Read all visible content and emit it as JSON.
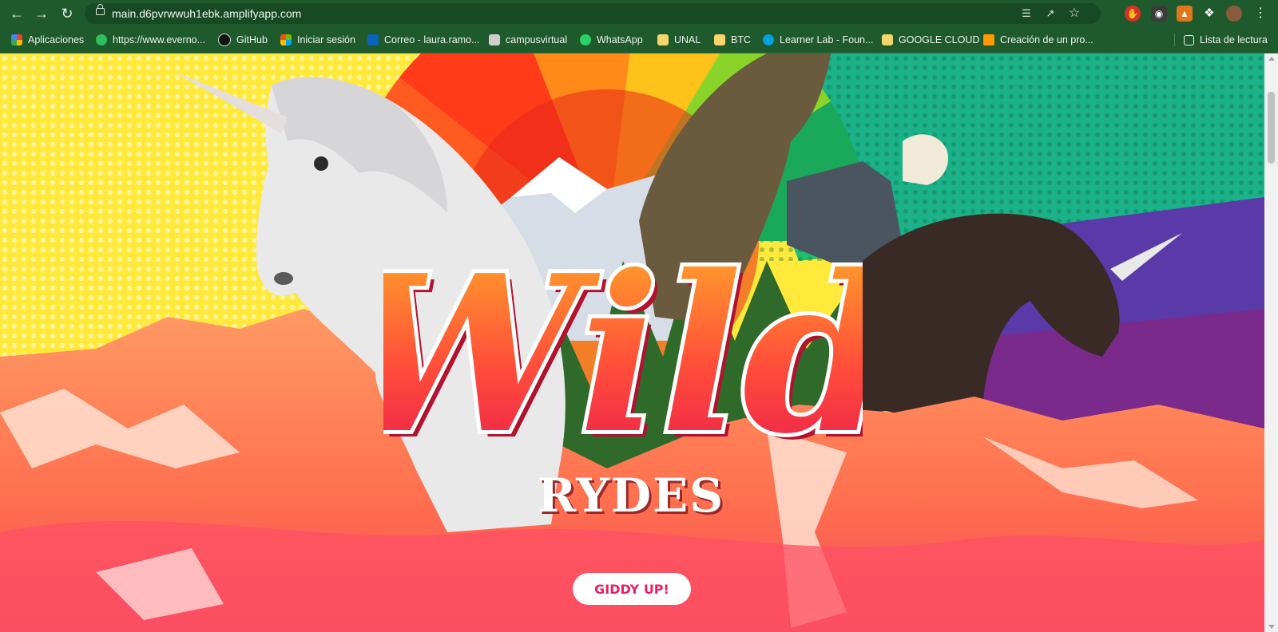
{
  "browser": {
    "url": "main.d6pvrwwuh1ebk.amplifyapp.com",
    "nav": {
      "back_icon": "arrow-left",
      "forward_icon": "arrow-right",
      "reload_icon": "reload"
    },
    "bookmarks": [
      {
        "label": "Aplicaciones",
        "icon": "apps-grid-icon",
        "color": "#e94235"
      },
      {
        "label": "https://www.everno...",
        "icon": "evernote-icon",
        "color": "#2dbe60"
      },
      {
        "label": "GitHub",
        "icon": "github-icon",
        "color": "#111111"
      },
      {
        "label": "Iniciar sesión",
        "icon": "microsoft-icon",
        "color": "#f25022"
      },
      {
        "label": "Correo - laura.ramo...",
        "icon": "outlook-icon",
        "color": "#0a64b8"
      },
      {
        "label": "campusvirtual",
        "icon": "campus-icon",
        "color": "#cfcfcf"
      },
      {
        "label": "WhatsApp",
        "icon": "whatsapp-icon",
        "color": "#25d366"
      },
      {
        "label": "UNAL",
        "icon": "folder-icon",
        "color": "#f6d66b"
      },
      {
        "label": "BTC",
        "icon": "folder-icon",
        "color": "#f6d66b"
      },
      {
        "label": "Learner Lab - Foun...",
        "icon": "salesforce-icon",
        "color": "#00a1e0"
      },
      {
        "label": "GOOGLE CLOUD",
        "icon": "folder-icon",
        "color": "#f6d66b"
      },
      {
        "label": "Creación de un pro...",
        "icon": "aws-icon",
        "color": "#ff9900"
      }
    ],
    "reading_list": "Lista de lectura"
  },
  "hero": {
    "logo_script": "Wild",
    "logo_word": "RYDES",
    "cta_label": "GIDDY UP!"
  },
  "colors": {
    "browser_green": "#1f5a2c",
    "cta_text": "#e81e63",
    "mountain_coral": "#ff7a52"
  }
}
